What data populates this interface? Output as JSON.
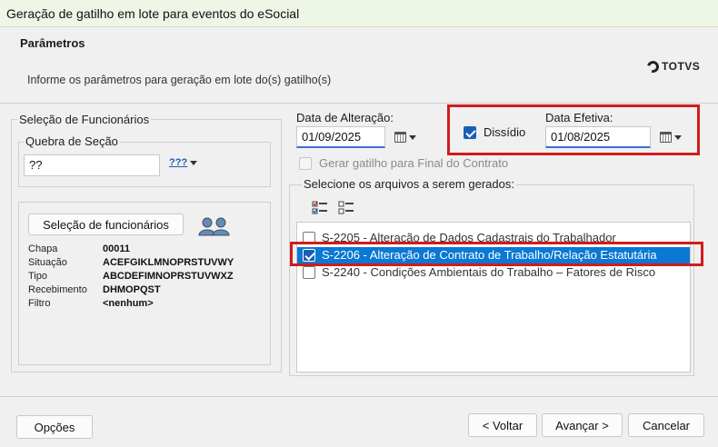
{
  "window": {
    "title": "Geração de gatilho em lote para eventos do eSocial"
  },
  "header": {
    "title": "Parâmetros",
    "subtitle": "Informe os parâmetros para geração em lote do(s) gatilho(s)",
    "logo_text": "TOTVS"
  },
  "funcionarios": {
    "group_label": "Seleção de Funcionários",
    "quebra_label": "Quebra de Seção",
    "quebra_value": "??",
    "quebra_btn": "???",
    "select_button": "Seleção de funcionários",
    "fields": [
      {
        "label": "Chapa",
        "value": "00011"
      },
      {
        "label": "Situação",
        "value": "ACEFGIKLMNOPRSTUVWY"
      },
      {
        "label": "Tipo",
        "value": "ABCDEFIMNOPRSTUVWXZ"
      },
      {
        "label": "Recebimento",
        "value": "DHMOPQST"
      },
      {
        "label": "Filtro",
        "value": "<nenhum>"
      }
    ]
  },
  "dates": {
    "alteracao_label": "Data de Alteração:",
    "alteracao_value": "01/09/2025",
    "dissidio_label": "Dissídio",
    "dissidio_checked": true,
    "efetiva_label": "Data Efetiva:",
    "efetiva_value": "01/08/2025"
  },
  "final_contrato": {
    "label": "Gerar gatilho para Final do Contrato",
    "checked": false
  },
  "arquivos": {
    "group_label": "Selecione os arquivos a serem gerados:",
    "items": [
      {
        "label": "S-2205 - Alteração de Dados Cadastrais do Trabalhador",
        "checked": false,
        "selected": false
      },
      {
        "label": "S-2206 - Alteração de Contrato de Trabalho/Relação Estatutária",
        "checked": true,
        "selected": true
      },
      {
        "label": "S-2240 - Condições Ambientais do Trabalho – Fatores de Risco",
        "checked": false,
        "selected": false
      }
    ]
  },
  "footer": {
    "options": "Opções",
    "back": "< Voltar",
    "next": "Avançar >",
    "cancel": "Cancelar"
  },
  "colors": {
    "selection": "#0a78d4",
    "highlight_box": "#d11b1b",
    "check": "#1a5fb4"
  }
}
